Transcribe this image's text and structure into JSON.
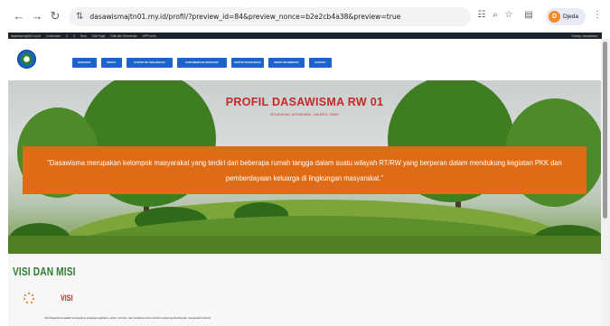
{
  "browser": {
    "url": "dasawismajtn01.my.id/profil/?preview_id=84&preview_nonce=b2e2cb4a38&preview=true",
    "profile_initial": "D",
    "profile_name": "Djeda"
  },
  "admin_bar": {
    "items": [
      "dasawismajtn01.my.id",
      "Customize",
      "0",
      "0",
      "New",
      "Edit Page",
      "Edit with Elementor",
      "WPForms"
    ],
    "howdy": "Howdy, dasawiswa"
  },
  "menu": {
    "items": [
      {
        "label": "BERANDA"
      },
      {
        "label": "PROFIL"
      },
      {
        "label": "STRUKTUR ORGANISASI"
      },
      {
        "label": "DOKUMENTASI KEGIATAN"
      },
      {
        "label": "MOTOR PENGGERAK"
      },
      {
        "label": "MEDIA INFORMATIF"
      },
      {
        "label": "KONTAK"
      }
    ]
  },
  "hero": {
    "title": "PROFIL DASAWISMA RW 01",
    "subtitle": "KELURAHAN JATINEGARA, JAKARTA TIMUR",
    "quote": "\"Dasawisma merupakan kelompok masyarakat yang terdiri dari beberapa rumah tangga dalam suatu wilayah RT/RW yang berperan dalam mendukung kegiatan PKK dan pemberdayaan keluarga di lingkungan masyarakat.\""
  },
  "visi_misi": {
    "section_title": "VISI DAN MISI",
    "visi_label": "VISI",
    "visi_text": "Visi Dasawisma adalah terwujudnya keluarga sejahtera, sehat, beriman, dan bertakwa serta mandiri melalui pemberdayaan masyarakat terkecil."
  },
  "colors": {
    "accent_orange": "#e06b17",
    "menu_blue": "#1e63c7",
    "title_red": "#c62828",
    "heading_green": "#2e7d32"
  }
}
